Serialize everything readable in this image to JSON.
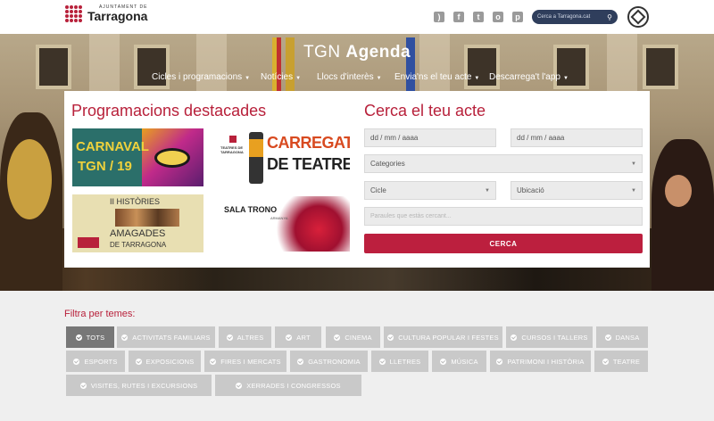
{
  "header": {
    "logo_small": "AJUNTAMENT DE",
    "logo_big": "Tarragona",
    "social_icons": [
      "rss-icon",
      "facebook-icon",
      "twitter-icon",
      "instagram-icon",
      "pinterest-icon"
    ],
    "search_placeholder": "Cerca a Tarragona.cat"
  },
  "hero": {
    "title_light": "TGN ",
    "title_bold": "Agenda",
    "nav": [
      "Cicles i programacions",
      "Notícies",
      "Llocs d'interès",
      "Envia'ns el teu acte",
      "Descarrega't l'app"
    ]
  },
  "featured": {
    "title": "Programacions destacades",
    "promos": [
      {
        "line1": "CARNAVAL",
        "line2": "TGN / 19"
      },
      {
        "line1": "CARREGATS",
        "line2": "DE TEATRE",
        "small": "TEATRES DE TARRAGONA"
      },
      {
        "line1": "II HISTÒRIES",
        "line2": "AMAGADES",
        "line3": "DE TARRAGONA"
      },
      {
        "line1": "SALA TRONO",
        "small": "ARMANYA"
      }
    ]
  },
  "search": {
    "title": "Cerca el teu acte",
    "date_from": "dd / mm / aaaa",
    "date_to": "dd / mm / aaaa",
    "categories": "Categories",
    "cycle": "Cicle",
    "location": "Ubicació",
    "keyword_placeholder": "Paraules que estàs cercant...",
    "button": "CERCA"
  },
  "filters": {
    "title": "Filtra per temes:",
    "tags": [
      "TOTS",
      "ACTIVITATS FAMILIARS",
      "ALTRES",
      "ART",
      "CINEMA",
      "CULTURA POPULAR I FESTES",
      "CURSOS I TALLERS",
      "DANSA",
      "ESPORTS",
      "EXPOSICIONS",
      "FIRES I MERCATS",
      "GASTRONOMIA",
      "LLETRES",
      "MÚSICA",
      "PATRIMONI I HISTÒRIA",
      "TEATRE",
      "VISITES, RUTES I EXCURSIONS",
      "XERRADES I CONGRESSOS"
    ]
  },
  "colors": {
    "accent": "#b8213b",
    "button": "#bc1f3e",
    "tag": "#c9c9c9",
    "tag_active": "#777777",
    "search_bar": "#2f3e5c"
  }
}
